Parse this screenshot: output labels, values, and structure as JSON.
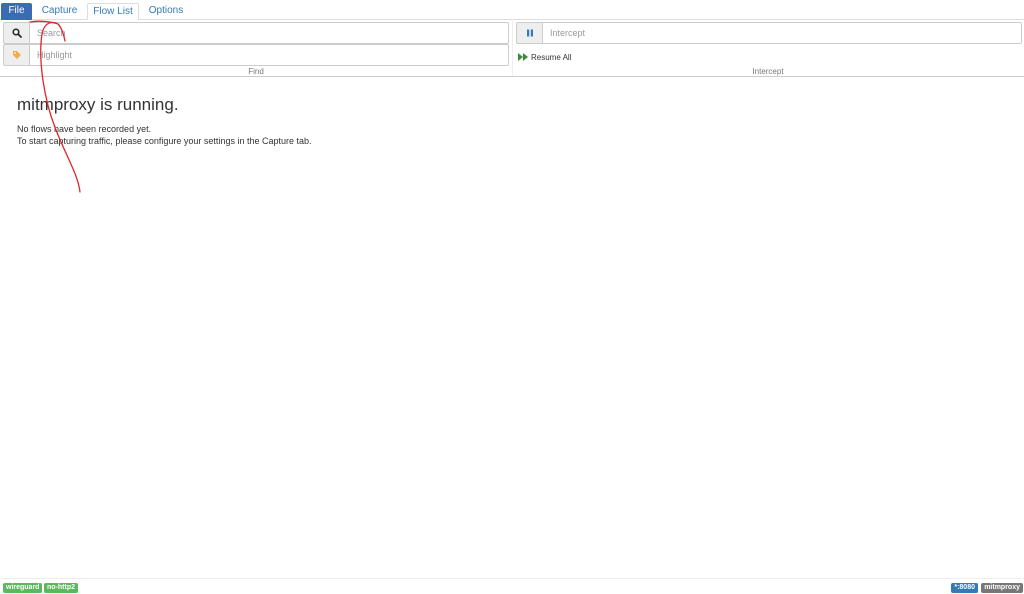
{
  "nav": {
    "tabs": [
      {
        "label": "File"
      },
      {
        "label": "Capture"
      },
      {
        "label": "Flow List"
      },
      {
        "label": "Options"
      }
    ]
  },
  "find": {
    "search_placeholder": "Search",
    "highlight_placeholder": "Highlight",
    "label": "Find"
  },
  "intercept": {
    "placeholder": "Intercept",
    "resume_all": "Resume All",
    "label": "Intercept"
  },
  "main": {
    "heading": "mitmproxy is running.",
    "line1": "No flows have been recorded yet.",
    "line2": "To start capturing traffic, please configure your settings in the Capture tab."
  },
  "footer": {
    "left_badges": [
      "wireguard",
      "no-http2"
    ],
    "port": "*:8080",
    "app": "mitmproxy"
  },
  "colors": {
    "accent": "#396cb2",
    "link": "#337ab7",
    "badge_green": "#5cb85c",
    "annotation": "#e0262a"
  }
}
